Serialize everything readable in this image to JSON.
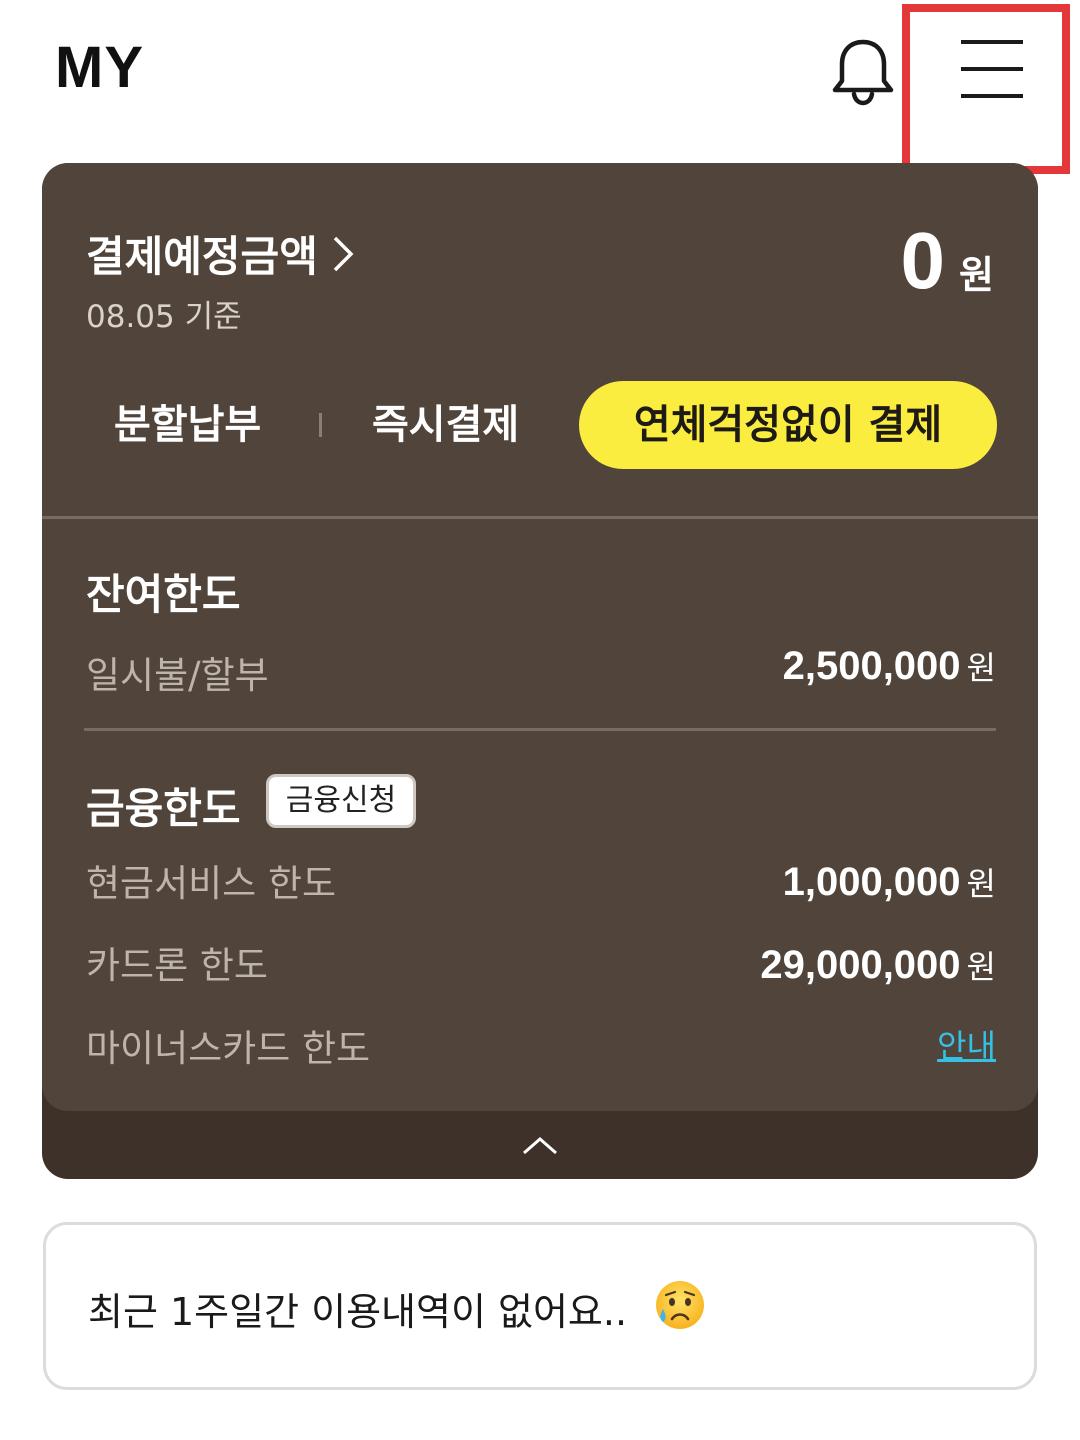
{
  "header": {
    "title": "MY",
    "notification_icon": "bell-icon",
    "menu_icon": "hamburger-menu-icon"
  },
  "payment": {
    "label": "결제예정금액",
    "date": "08.05 기준",
    "amount": "0",
    "unit": "원"
  },
  "tabs": [
    {
      "label": "분할납부",
      "active": false
    },
    {
      "label": "즉시결제",
      "active": false
    },
    {
      "label": "연체걱정없이 결제",
      "active": true
    }
  ],
  "remaining_limit": {
    "title": "잔여한도",
    "rows": [
      {
        "label": "일시불/할부",
        "value": "2,500,000",
        "unit": "원"
      }
    ]
  },
  "finance_limit": {
    "title": "금융한도",
    "apply_button": "금융신청",
    "rows": [
      {
        "label": "현금서비스 한도",
        "value": "1,000,000",
        "unit": "원"
      },
      {
        "label": "카드론 한도",
        "value": "29,000,000",
        "unit": "원"
      },
      {
        "label": "마이너스카드 한도",
        "link": "안내"
      }
    ]
  },
  "notice": {
    "text": "최근 1주일간 이용내역이 없어요.."
  },
  "colors": {
    "card_bg": "#50443b",
    "card_footer": "#3e3129",
    "accent_yellow": "#fbed3f",
    "link": "#34c1e4",
    "highlight": "#e3373a"
  }
}
